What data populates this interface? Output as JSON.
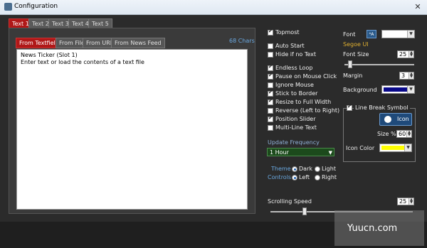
{
  "window": {
    "title": "Configuration",
    "close_glyph": "✕"
  },
  "text_tabs": [
    "Text 1",
    "Text 2",
    "Text 3",
    "Text 4",
    "Text 5"
  ],
  "source_tabs": [
    "From Textfield",
    "From File",
    "From URL",
    "From News Feed"
  ],
  "char_count": "68 Chars",
  "textfield": {
    "line1": "News Ticker (Slot 1)",
    "line2": "Enter text or load the contents of a text file"
  },
  "options": [
    {
      "label": "Topmost",
      "checked": true
    },
    {
      "label": "Auto Start",
      "checked": false
    },
    {
      "label": "Hide if no Text",
      "checked": false
    },
    {
      "label": "Endless Loop",
      "checked": true
    },
    {
      "label": "Pause on Mouse Click",
      "checked": true
    },
    {
      "label": "Ignore Mouse",
      "checked": false
    },
    {
      "label": "Stick to Border",
      "checked": true
    },
    {
      "label": "Resize to Full Width",
      "checked": true
    },
    {
      "label": "Reverse (Left to Right)",
      "checked": false
    },
    {
      "label": "Position Slider",
      "checked": true
    },
    {
      "label": "Multi-Line Text",
      "checked": false
    }
  ],
  "update_frequency": {
    "label": "Update Frequency",
    "value": "1 Hour"
  },
  "theme": {
    "label": "Theme",
    "dark": "Dark",
    "light": "Light",
    "selected": "Dark"
  },
  "controls": {
    "label": "Controls",
    "left": "Left",
    "right": "Right",
    "selected": "Left"
  },
  "scrolling_speed": {
    "label": "Scrolling Speed",
    "value": "25"
  },
  "font": {
    "label": "Font",
    "name": "Segoe UI",
    "icon": "font-picker-icon"
  },
  "font_size": {
    "label": "Font Size",
    "value": "25"
  },
  "margin": {
    "label": "Margin",
    "value": "3"
  },
  "background": {
    "label": "Background",
    "color": "#0a0a8a"
  },
  "line_break": {
    "label": "Line Break Symbol",
    "checked": true,
    "icon_button": "Icon",
    "size_label": "Size %",
    "size_value": "60",
    "icon_color_label": "Icon Color",
    "icon_color": "#ffff00"
  },
  "watermark": "Yuucn.com"
}
